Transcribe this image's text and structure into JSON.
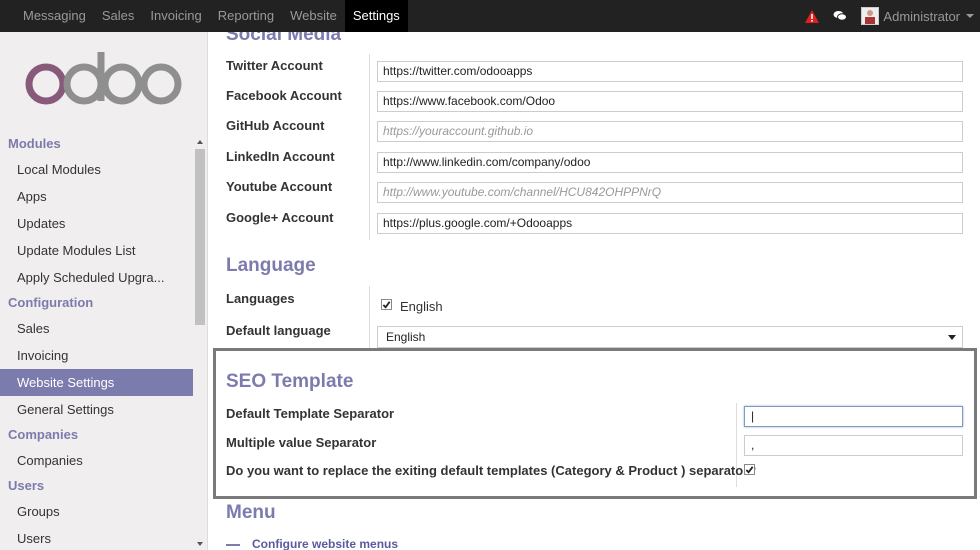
{
  "topbar": {
    "menu": [
      "Messaging",
      "Sales",
      "Invoicing",
      "Reporting",
      "Website",
      "Settings"
    ],
    "active": "Settings",
    "user": "Administrator"
  },
  "sidebar": {
    "logo": "odoo",
    "sections": [
      {
        "title": "Modules",
        "items": [
          "Local Modules",
          "Apps",
          "Updates",
          "Update Modules List",
          "Apply Scheduled Upgra..."
        ]
      },
      {
        "title": "Configuration",
        "items": [
          "Sales",
          "Invoicing",
          "Website Settings",
          "General Settings"
        ]
      },
      {
        "title": "Companies",
        "items": [
          "Companies"
        ]
      },
      {
        "title": "Users",
        "items": [
          "Groups",
          "Users"
        ]
      }
    ],
    "active": "Website Settings"
  },
  "social": {
    "title": "Social Media",
    "fields": [
      {
        "label": "Twitter Account",
        "value": "https://twitter.com/odooapps",
        "placeholder": ""
      },
      {
        "label": "Facebook Account",
        "value": "https://www.facebook.com/Odoo",
        "placeholder": ""
      },
      {
        "label": "GitHub Account",
        "value": "",
        "placeholder": "https://youraccount.github.io"
      },
      {
        "label": "LinkedIn Account",
        "value": "http://www.linkedin.com/company/odoo",
        "placeholder": ""
      },
      {
        "label": "Youtube Account",
        "value": "",
        "placeholder": "http://www.youtube.com/channel/HCU842OHPPNrQ"
      },
      {
        "label": "Google+ Account",
        "value": "https://plus.google.com/+Odooapps",
        "placeholder": ""
      }
    ]
  },
  "language": {
    "title": "Language",
    "languages_label": "Languages",
    "language_option": "English",
    "default_label": "Default language",
    "default_value": "English"
  },
  "seo": {
    "title": "SEO Template",
    "separator_label": "Default Template Separator",
    "separator_value": "|",
    "multi_label": "Multiple value Separator",
    "multi_value": ",",
    "replace_label": "Do you want to replace the exiting default templates (Category & Product ) separator?"
  },
  "menu": {
    "title": "Menu",
    "link": "Configure website menus"
  },
  "colors": {
    "accent": "#7c7bad",
    "topbar": "#222222"
  }
}
